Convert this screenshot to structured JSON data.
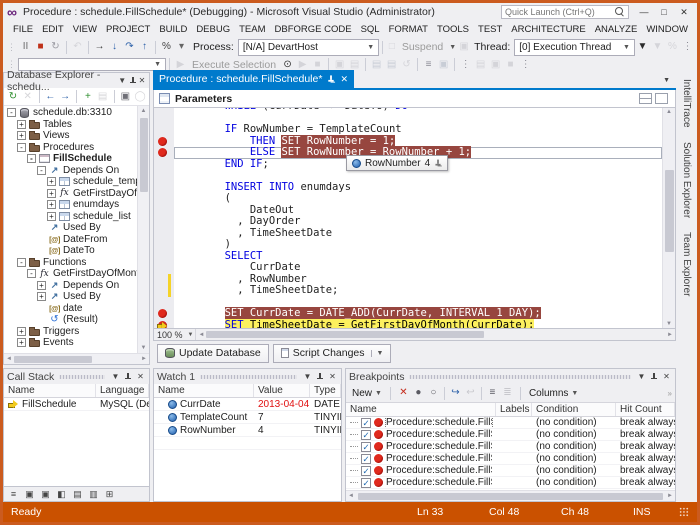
{
  "colors": {
    "accent": "#007ACC",
    "status_bar": "#CA5100",
    "breakpoint_highlight": "#97463F",
    "current_statement": "#FCF05E",
    "keyword": "#0000E0",
    "breakpoint_red": "#E0291D",
    "error_value_red": "#E01010",
    "window_border": "#CB5B1F",
    "logo_purple": "#68217A"
  },
  "window": {
    "title": "Procedure : schedule.FillSchedule* (Debugging) - Microsoft Visual Studio (Administrator)",
    "quick_launch_placeholder": "Quick Launch (Ctrl+Q)",
    "controls": [
      {
        "name": "minimize-button",
        "glyph": "—"
      },
      {
        "name": "maximize-button",
        "glyph": "□"
      },
      {
        "name": "close-button",
        "glyph": "✕"
      }
    ]
  },
  "menu": {
    "items": [
      "FILE",
      "EDIT",
      "VIEW",
      "PROJECT",
      "BUILD",
      "DEBUG",
      "TEAM",
      "DBFORGE CODE",
      "SQL",
      "FORMAT",
      "TOOLS",
      "TEST",
      "ARCHITECTURE",
      "ANALYZE",
      "WINDOW",
      "HELP"
    ]
  },
  "toolbar": {
    "icons1": [
      {
        "name": "break-all-icon",
        "glyph": "II",
        "color": "#6f6f6f"
      },
      {
        "name": "stop-debugging-icon",
        "glyph": "■",
        "color": "#BF3119"
      },
      {
        "name": "restart-icon",
        "glyph": "↻",
        "color": "#9a9aa2"
      },
      {
        "name": "sep"
      },
      {
        "name": "undo-icon",
        "glyph": "↶",
        "color": "#b5b5bc",
        "disabled": true
      },
      {
        "name": "sep"
      },
      {
        "name": "show-next-statement-icon",
        "glyph": "→",
        "color": "#3a3a3a"
      },
      {
        "name": "step-into-icon",
        "glyph": "↓",
        "color": "#2a5fa8"
      },
      {
        "name": "step-over-icon",
        "glyph": "↷",
        "color": "#2a5fa8"
      },
      {
        "name": "step-out-icon",
        "glyph": "↑",
        "color": "#2a5fa8"
      },
      {
        "name": "sep"
      },
      {
        "name": "hex-display-icon",
        "glyph": "%",
        "color": "#444"
      },
      {
        "name": "overflow-chevron-icon",
        "glyph": "▾",
        "color": "#666"
      }
    ],
    "process_label": "Process:",
    "process_value": "[N/A] DevartHost",
    "suspend_icon_left": {
      "name": "suspend-left-icon",
      "glyph": "□",
      "color": "#b5b5bc"
    },
    "suspend_label": "Suspend",
    "suspend_icon_right": {
      "name": "suspend-right-icon",
      "glyph": "▣",
      "color": "#b5b5bc"
    },
    "thread_label": "Thread:",
    "thread_value": "[0] Execution Thread",
    "icons1_end": [
      {
        "name": "filter-funnel-icon",
        "glyph": "▼",
        "color": "#2b2b2b"
      },
      {
        "name": "flag-icon",
        "glyph": "▼",
        "color": "#b5b5bc",
        "disabled": true
      },
      {
        "name": "frames-icon",
        "glyph": "%",
        "color": "#b5b5bc",
        "disabled": true
      },
      {
        "name": "overflow-grip-icon",
        "glyph": "⋮",
        "color": "#8a8a94"
      }
    ],
    "icons2_pre": [
      {
        "name": "attach-icon",
        "glyph": "▶",
        "color": "#b5b5bc",
        "disabled": true
      }
    ],
    "execute_selection_label": "Execute Selection",
    "icons2": [
      {
        "name": "debug-procedure-icon",
        "glyph": "⊙",
        "color": "#2b2b2b"
      },
      {
        "name": "start-icon",
        "glyph": "▶",
        "color": "#b5b5bc",
        "disabled": true
      },
      {
        "name": "stop-icon",
        "glyph": "■",
        "color": "#b5b5bc",
        "disabled": true
      },
      {
        "name": "sep"
      },
      {
        "name": "frame-icon",
        "glyph": "▣",
        "color": "#b5b5bc",
        "disabled": true
      },
      {
        "name": "layout-icon",
        "glyph": "▤",
        "color": "#b5b5bc",
        "disabled": true
      },
      {
        "name": "sep"
      },
      {
        "name": "step-list-icon",
        "glyph": "▤",
        "color": "#9aa4b5",
        "disabled": true
      },
      {
        "name": "step-list2-icon",
        "glyph": "▤",
        "color": "#9aa4b5",
        "disabled": true
      },
      {
        "name": "history-icon",
        "glyph": "↺",
        "color": "#b5b5bc",
        "disabled": true
      },
      {
        "name": "sep"
      },
      {
        "name": "list-members-icon",
        "glyph": "≡",
        "color": "#8a8a94"
      },
      {
        "name": "quick-info-icon",
        "glyph": "▣",
        "color": "#9aa4b5",
        "disabled": true
      },
      {
        "name": "sep"
      },
      {
        "name": "outline-icon",
        "glyph": "⋮",
        "color": "#8a8a94"
      },
      {
        "name": "misc1-icon",
        "glyph": "▤",
        "color": "#b5b5bc",
        "disabled": true
      },
      {
        "name": "misc2-icon",
        "glyph": "▣",
        "color": "#b5b5bc",
        "disabled": true
      },
      {
        "name": "misc3-icon",
        "glyph": "■",
        "color": "#b5b5bc",
        "disabled": true
      },
      {
        "name": "overflow-grip2-icon",
        "glyph": "⋮",
        "color": "#8a8a94"
      }
    ]
  },
  "db_explorer": {
    "title": "Database Explorer - schedu...",
    "toolbar_icons": [
      {
        "name": "refresh-icon",
        "glyph": "↻",
        "color": "#2f8f2f"
      },
      {
        "name": "stop-refresh-icon",
        "glyph": "✕",
        "color": "#a5a5ad",
        "disabled": true
      },
      {
        "name": "sep"
      },
      {
        "name": "back-icon",
        "glyph": "←",
        "color": "#2a5fa8"
      },
      {
        "name": "forward-icon",
        "glyph": "→",
        "color": "#2a5fa8"
      },
      {
        "name": "sep"
      },
      {
        "name": "new-connection-icon",
        "glyph": "+",
        "color": "#2f8f2f"
      },
      {
        "name": "edit-connection-icon",
        "glyph": "▤",
        "color": "#a5a5ad",
        "disabled": true
      },
      {
        "name": "sep"
      },
      {
        "name": "duplicate-icon",
        "glyph": "▣",
        "color": "#6f6f77"
      },
      {
        "name": "more-icon",
        "glyph": "◯",
        "color": "#a5a5ad",
        "disabled": true
      }
    ],
    "tree": [
      {
        "label": "schedule.db:3310",
        "icon": "database",
        "exp": "-",
        "level": 0
      },
      {
        "label": "Tables",
        "icon": "folder",
        "exp": "+",
        "level": 1
      },
      {
        "label": "Views",
        "icon": "folder",
        "exp": "+",
        "level": 1
      },
      {
        "label": "Procedures",
        "icon": "folder",
        "exp": "-",
        "level": 1
      },
      {
        "label": "FillSchedule",
        "icon": "procedure",
        "exp": "-",
        "level": 2,
        "bold": true
      },
      {
        "label": "Depends On",
        "icon": "depends",
        "exp": "-",
        "level": 3
      },
      {
        "label": "schedule_temp",
        "icon": "table",
        "exp": "+",
        "level": 4
      },
      {
        "label": "GetFirstDayOf",
        "icon": "function",
        "exp": "+",
        "level": 4
      },
      {
        "label": "enumdays",
        "icon": "table",
        "exp": "+",
        "level": 4
      },
      {
        "label": "schedule_list",
        "icon": "table",
        "exp": "+",
        "level": 4
      },
      {
        "label": "Used By",
        "icon": "depends",
        "exp": null,
        "level": 3
      },
      {
        "label": "DateFrom",
        "icon": "param",
        "exp": null,
        "level": 3
      },
      {
        "label": "DateTo",
        "icon": "param",
        "exp": null,
        "level": 3
      },
      {
        "label": "Functions",
        "icon": "folder",
        "exp": "-",
        "level": 1
      },
      {
        "label": "GetFirstDayOfMonth",
        "icon": "function",
        "exp": "-",
        "level": 2
      },
      {
        "label": "Depends On",
        "icon": "depends",
        "exp": "+",
        "level": 3
      },
      {
        "label": "Used By",
        "icon": "depends",
        "exp": "+",
        "level": 3
      },
      {
        "label": "date",
        "icon": "param",
        "exp": null,
        "level": 3
      },
      {
        "label": "(Result)",
        "icon": "result",
        "exp": null,
        "level": 3
      },
      {
        "label": "Triggers",
        "icon": "folder",
        "exp": "+",
        "level": 1
      },
      {
        "label": "Events",
        "icon": "folder",
        "exp": "+",
        "level": 1
      }
    ]
  },
  "editor": {
    "tab_title": "Procedure : schedule.FillSchedule*",
    "parameters_label": "Parameters",
    "zoom_label": "100 %",
    "update_database_label": "Update Database",
    "script_changes_label": "Script Changes",
    "datatip": {
      "name": "RowNumber",
      "value": "4"
    },
    "code_lines": [
      {
        "clip": true,
        "seg": [
          [
            "        ",
            "p"
          ],
          [
            "WHILE ",
            "k"
          ],
          [
            "(CurrDate <= DateTo) ",
            "p"
          ],
          [
            "DO",
            "k"
          ]
        ]
      },
      {
        "seg": []
      },
      {
        "seg": [
          [
            "        ",
            "p"
          ],
          [
            "IF ",
            "k"
          ],
          [
            "RowNumber = TemplateCount",
            "p"
          ]
        ]
      },
      {
        "m": "bp",
        "seg": [
          [
            "            ",
            "p"
          ],
          [
            "THEN ",
            "k"
          ],
          [
            "SET RowNumber = 1;",
            "r"
          ]
        ]
      },
      {
        "m": "bp",
        "outline": true,
        "seg": [
          [
            "            ",
            "p"
          ],
          [
            "ELSE ",
            "k"
          ],
          [
            "SET RowNumber = RowNumber + 1;",
            "r"
          ]
        ]
      },
      {
        "seg": [
          [
            "        ",
            "p"
          ],
          [
            "END IF",
            "k"
          ],
          [
            ";",
            "p"
          ]
        ]
      },
      {
        "seg": []
      },
      {
        "seg": [
          [
            "        ",
            "p"
          ],
          [
            "INSERT INTO ",
            "k"
          ],
          [
            "enumdays",
            "p"
          ]
        ]
      },
      {
        "seg": [
          [
            "        (",
            "p"
          ]
        ]
      },
      {
        "seg": [
          [
            "            DateOut",
            "p"
          ]
        ]
      },
      {
        "seg": [
          [
            "          , DayOrder",
            "p"
          ]
        ]
      },
      {
        "seg": [
          [
            "          , TimeSheetDate",
            "p"
          ]
        ]
      },
      {
        "seg": [
          [
            "        )",
            "p"
          ]
        ]
      },
      {
        "seg": [
          [
            "        ",
            "p"
          ],
          [
            "SELECT",
            "k"
          ]
        ]
      },
      {
        "seg": [
          [
            "            CurrDate",
            "p"
          ]
        ]
      },
      {
        "chg": true,
        "seg": [
          [
            "          , RowNumber",
            "p"
          ]
        ]
      },
      {
        "chg": true,
        "seg": [
          [
            "          , TimeSheetDate;",
            "p"
          ]
        ]
      },
      {
        "seg": []
      },
      {
        "m": "bp",
        "seg": [
          [
            "        ",
            "p"
          ],
          [
            "SET CurrDate = DATE_ADD(CurrDate, INTERVAL 1 DAY);",
            "r"
          ]
        ]
      },
      {
        "m": "cur",
        "seg": [
          [
            "        ",
            "p"
          ],
          [
            "SET ",
            "yk"
          ],
          [
            "TimeSheetDate = GetFirstDayOfMonth(CurrDate);",
            "y"
          ]
        ]
      }
    ]
  },
  "call_stack": {
    "title": "Call Stack",
    "columns": [
      "Name",
      "Language"
    ],
    "rows": [
      {
        "name": "FillSchedule",
        "language": "MySQL (Devart)"
      }
    ],
    "dock_icons": [
      {
        "name": "dock-callstack-icon",
        "glyph": "≡"
      },
      {
        "name": "dock-breakpoints-icon",
        "glyph": "▣"
      },
      {
        "name": "dock-command-icon",
        "glyph": "▣"
      },
      {
        "name": "dock-immediate-icon",
        "glyph": "◧"
      },
      {
        "name": "dock-locals-icon",
        "glyph": "▤"
      },
      {
        "name": "dock-autos-icon",
        "glyph": "▥"
      },
      {
        "name": "dock-output-icon",
        "glyph": "⊞"
      }
    ]
  },
  "watch": {
    "title": "Watch 1",
    "columns": [
      "Name",
      "Value",
      "Type"
    ],
    "rows": [
      {
        "name": "CurrDate",
        "value": "2013-04-04",
        "type": "DATE",
        "value_red": true
      },
      {
        "name": "TemplateCount",
        "value": "7",
        "type": "TINYINT",
        "value_red": false
      },
      {
        "name": "RowNumber",
        "value": "4",
        "type": "TINYINT",
        "value_red": false
      }
    ]
  },
  "breakpoints": {
    "title": "Breakpoints",
    "toolbar": {
      "new_label": "New",
      "columns_label": "Columns",
      "icons": [
        {
          "name": "delete-breakpoint-icon",
          "glyph": "✕",
          "color": "#C42B1C"
        },
        {
          "name": "delete-all-breakpoints-icon",
          "glyph": "●",
          "color": "#5a5a62"
        },
        {
          "name": "toggle-all-breakpoints-icon",
          "glyph": "○",
          "color": "#5a5a62"
        },
        {
          "name": "sep"
        },
        {
          "name": "goto-source-icon",
          "glyph": "↪",
          "color": "#2a5fa8"
        },
        {
          "name": "goto-disassembly-icon",
          "glyph": "↩",
          "color": "#9a9aa2",
          "disabled": true
        },
        {
          "name": "sep"
        },
        {
          "name": "export-breakpoints-icon",
          "glyph": "≡",
          "color": "#5a5a62"
        },
        {
          "name": "import-breakpoints-icon",
          "glyph": "≣",
          "color": "#9a9aa2",
          "disabled": true
        }
      ]
    },
    "columns": [
      "Name",
      "Labels",
      "Condition",
      "Hit Count"
    ],
    "rows": [
      {
        "name": "Procedure:schedule.FillSchedule(",
        "labels": "",
        "condition": "(no condition)",
        "hit_count": "break always (current",
        "checked": true,
        "focused": true
      },
      {
        "name": "Procedure:schedule.FillSchedule(",
        "labels": "",
        "condition": "(no condition)",
        "hit_count": "break always (current",
        "checked": true
      },
      {
        "name": "Procedure:schedule.FillSchedule(",
        "labels": "",
        "condition": "(no condition)",
        "hit_count": "break always (current",
        "checked": true
      },
      {
        "name": "Procedure:schedule.FillSchedule(",
        "labels": "",
        "condition": "(no condition)",
        "hit_count": "break always (current",
        "checked": true
      },
      {
        "name": "Procedure:schedule.FillSchedule(",
        "labels": "",
        "condition": "(no condition)",
        "hit_count": "break always (current",
        "checked": true
      },
      {
        "name": "Procedure:schedule.FillSchedule(",
        "labels": "",
        "condition": "(no condition)",
        "hit_count": "break always (current",
        "checked": true
      }
    ]
  },
  "side_tabs": [
    "IntelliTrace",
    "Solution Explorer",
    "Team Explorer"
  ],
  "status_bar": {
    "ready": "Ready",
    "items": [
      "Ln 33",
      "Col 48",
      "Ch 48",
      "INS"
    ]
  }
}
